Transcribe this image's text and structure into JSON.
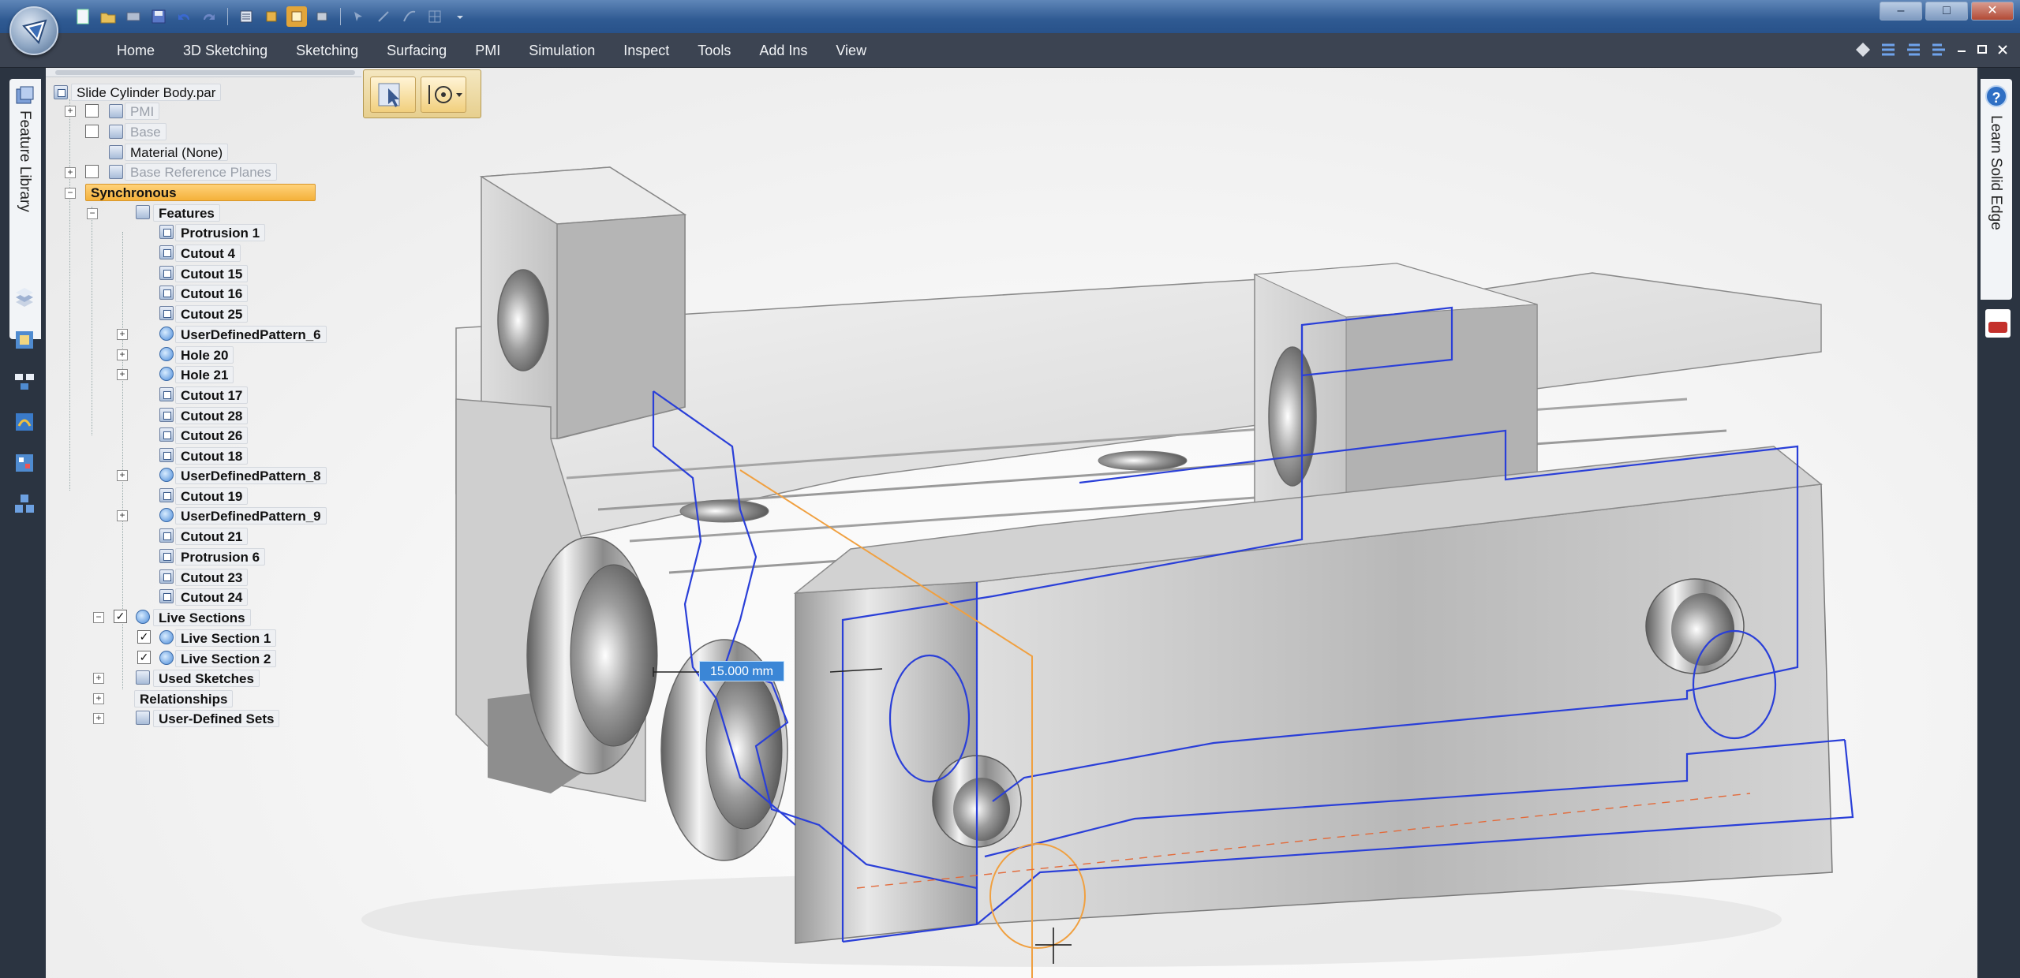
{
  "ribbon": {
    "tabs": [
      "Home",
      "3D Sketching",
      "Sketching",
      "Surfacing",
      "PMI",
      "Simulation",
      "Inspect",
      "Tools",
      "Add Ins",
      "View"
    ]
  },
  "window": {
    "controls": [
      "–",
      "□",
      "✕"
    ]
  },
  "left_strip": {
    "feature_library_label": "Feature Library",
    "icons": [
      "layers-icon",
      "sensors-icon",
      "assembly-icon",
      "favorites-icon",
      "family-icon",
      "layout-icon"
    ]
  },
  "right_strip": {
    "learn_label": "Learn Solid Edge",
    "help_glyph": "?"
  },
  "tree": {
    "root": "Slide Cylinder Body.par",
    "pmi": "PMI",
    "base": "Base",
    "material": "Material (None)",
    "base_ref_planes": "Base Reference Planes",
    "synchronous": "Synchronous",
    "features": "Features",
    "feature_items": [
      {
        "label": "Protrusion 1",
        "expand": false
      },
      {
        "label": "Cutout 4",
        "expand": false
      },
      {
        "label": "Cutout 15",
        "expand": false
      },
      {
        "label": "Cutout 16",
        "expand": false
      },
      {
        "label": "Cutout 25",
        "expand": false
      },
      {
        "label": "UserDefinedPattern_6",
        "expand": true
      },
      {
        "label": "Hole 20",
        "expand": true
      },
      {
        "label": "Hole 21",
        "expand": true
      },
      {
        "label": "Cutout 17",
        "expand": false
      },
      {
        "label": "Cutout 28",
        "expand": false
      },
      {
        "label": "Cutout 26",
        "expand": false
      },
      {
        "label": "Cutout 18",
        "expand": false
      },
      {
        "label": "UserDefinedPattern_8",
        "expand": true
      },
      {
        "label": "Cutout 19",
        "expand": false
      },
      {
        "label": "UserDefinedPattern_9",
        "expand": true
      },
      {
        "label": "Cutout 21",
        "expand": false
      },
      {
        "label": "Protrusion 6",
        "expand": false
      },
      {
        "label": "Cutout 23",
        "expand": false
      },
      {
        "label": "Cutout 24",
        "expand": false
      }
    ],
    "live_sections": "Live Sections",
    "live_section_1": "Live Section 1",
    "live_section_2": "Live Section 2",
    "used_sketches": "Used Sketches",
    "relationships": "Relationships",
    "user_defined_sets": "User-Defined Sets"
  },
  "viewport": {
    "dimension_value": "15.000 mm"
  },
  "colors": {
    "ribbon_bg": "#3c4452",
    "selection": "#f4b13a",
    "section_line": "#2a3fd8",
    "highlight_line": "#f0a040"
  }
}
